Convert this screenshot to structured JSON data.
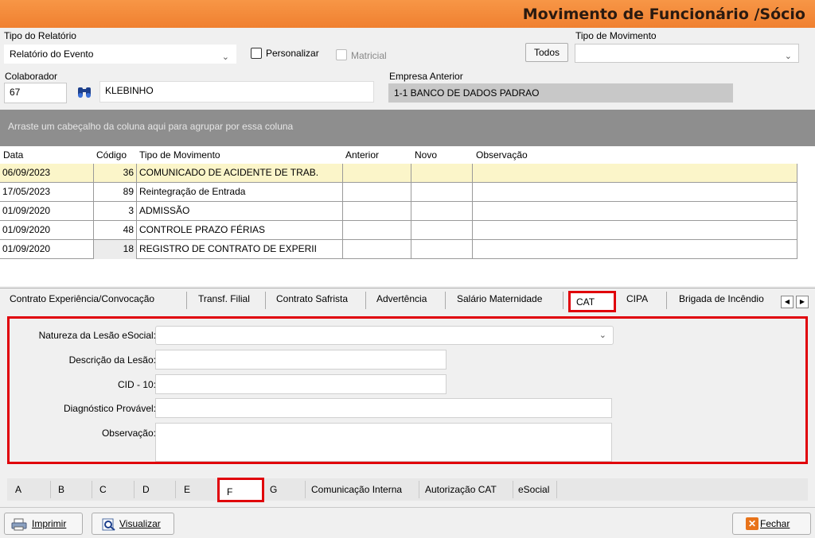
{
  "window": {
    "title": "Movimento de Funcionário /Sócio"
  },
  "filters": {
    "tipo_relatorio_label": "Tipo do Relatório",
    "tipo_relatorio_value": "Relatório do Evento",
    "personalizar_label": "Personalizar",
    "matricial_label": "Matricial",
    "todos_label": "Todos",
    "tipo_movimento_label": "Tipo de Movimento",
    "tipo_movimento_value": ""
  },
  "colaborador": {
    "label": "Colaborador",
    "code": "67",
    "name": "KLEBINHO",
    "empresa_label": "Empresa Anterior",
    "empresa_value": "1-1  BANCO DE DADOS PADRAO"
  },
  "grid": {
    "group_hint": "Arraste um cabeçalho da coluna aqui para agrupar por essa coluna",
    "columns": [
      "Data",
      "Código",
      "Tipo de Movimento",
      "Anterior",
      "Novo",
      "Observação"
    ],
    "rows": [
      {
        "data": "06/09/2023",
        "codigo": "36",
        "tipo": "COMUNICADO DE ACIDENTE DE TRAB.",
        "anterior": "",
        "novo": "",
        "obs": ""
      },
      {
        "data": "17/05/2023",
        "codigo": "89",
        "tipo": "Reintegração de Entrada",
        "anterior": "",
        "novo": "",
        "obs": ""
      },
      {
        "data": "01/09/2020",
        "codigo": "3",
        "tipo": "ADMISSÃO",
        "anterior": "",
        "novo": "",
        "obs": ""
      },
      {
        "data": "01/09/2020",
        "codigo": "48",
        "tipo": "CONTROLE PRAZO FÉRIAS",
        "anterior": "",
        "novo": "",
        "obs": ""
      },
      {
        "data": "01/09/2020",
        "codigo": "18",
        "tipo": "REGISTRO DE CONTRATO DE EXPERII",
        "anterior": "",
        "novo": "",
        "obs": ""
      }
    ]
  },
  "tabs": [
    "Contrato Experiência/Convocação",
    "Transf. Filial",
    "Contrato Safrista",
    "Advertência",
    "Salário Maternidade",
    "CAT",
    "CIPA",
    "Brigada de Incêndio"
  ],
  "cat_panel": {
    "natureza_label": "Natureza da Lesão eSocial:",
    "descricao_label": "Descrição da Lesão:",
    "cid_label": "CID - 10:",
    "diagnostico_label": "Diagnóstico Provável:",
    "observacao_label": "Observação:"
  },
  "subtabs": [
    "A",
    "B",
    "C",
    "D",
    "E",
    "F",
    "G",
    "Comunicação Interna",
    "Autorização CAT",
    "eSocial"
  ],
  "footer": {
    "imprimir": "Imprimir",
    "visualizar": "Visualizar",
    "fechar": "Fechar"
  },
  "colors": {
    "title_bar": "#f79646",
    "highlight": "#e0000a",
    "selected_row": "#fbf5c9"
  }
}
